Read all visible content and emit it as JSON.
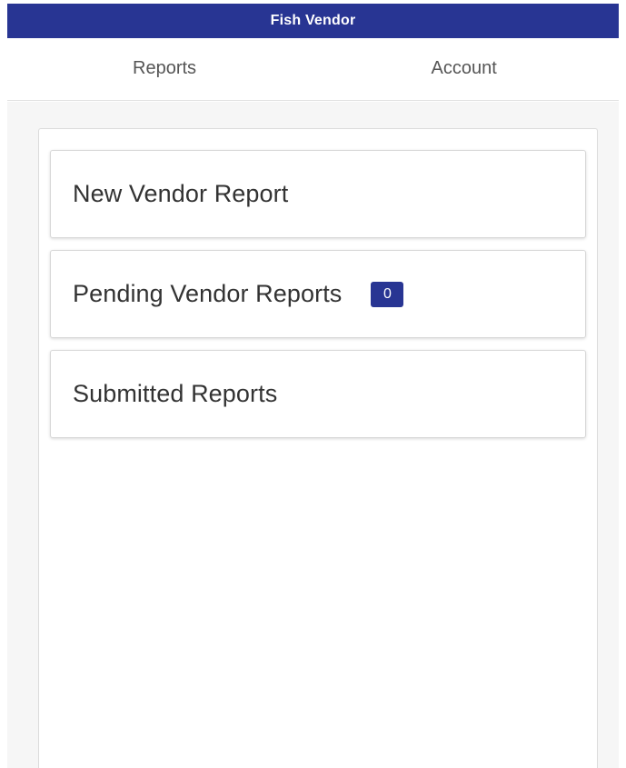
{
  "app": {
    "title": "Fish Vendor",
    "accent_color": "#283593"
  },
  "nav": {
    "tabs": [
      {
        "label": "Reports"
      },
      {
        "label": "Account"
      }
    ]
  },
  "menu": {
    "items": [
      {
        "label": "New Vendor Report"
      },
      {
        "label": "Pending Vendor Reports",
        "badge": "0"
      },
      {
        "label": "Submitted Reports"
      }
    ]
  }
}
